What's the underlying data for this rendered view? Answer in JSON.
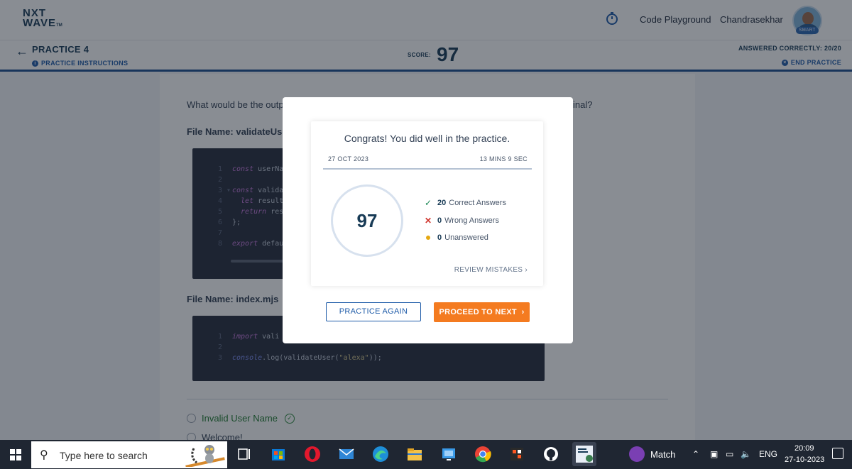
{
  "brand": {
    "line1": "NXT",
    "line2": "WAVE",
    "tm": "TM"
  },
  "topnav": {
    "code_playground": "Code Playground",
    "user_name": "Chandrasekhar",
    "avatar_badge": "SMART"
  },
  "subheader": {
    "title": "PRACTICE 4",
    "instructions": "PRACTICE INSTRUCTIONS",
    "score_label": "SCORE:",
    "score_value": "97",
    "answered": "ANSWERED CORRECTLY: 20/20",
    "end_practice": "END PRACTICE"
  },
  "question": {
    "text_left": "What would be the outp",
    "text_right": "inal?",
    "file1": "File Name: validateUse",
    "file2": "File Name: index.mjs",
    "code1": [
      {
        "n": "1",
        "kw": "const",
        "rest": " userNa"
      },
      {
        "n": "2",
        "kw": "",
        "rest": ""
      },
      {
        "n": "3 ▾",
        "kw": "const",
        "rest": " valida"
      },
      {
        "n": "4",
        "kw": "  let",
        "rest": " result"
      },
      {
        "n": "5",
        "kw": "  return",
        "rest": " res"
      },
      {
        "n": "6",
        "kw": "",
        "rest": "};"
      },
      {
        "n": "7",
        "kw": "",
        "rest": ""
      },
      {
        "n": "8",
        "kw": "export",
        "rest": " defau"
      }
    ],
    "code2": [
      {
        "n": "1",
        "kw": "import",
        "rest": " vali"
      },
      {
        "n": "2",
        "kw": "",
        "rest": ""
      },
      {
        "n": "3",
        "kw": "console",
        "rest": ".log(validateUser(",
        "str": "\"alexa\"",
        "tail": "));"
      }
    ],
    "options": [
      "Invalid User Name",
      "Welcome!"
    ]
  },
  "modal": {
    "congrats": "Congrats! You did well in the practice.",
    "date": "27 OCT 2023",
    "duration": "13 MINS 9 SEC",
    "score": "97",
    "stats": [
      {
        "count": "20",
        "label": "Correct Answers"
      },
      {
        "count": "0",
        "label": "Wrong Answers"
      },
      {
        "count": "0",
        "label": "Unanswered"
      }
    ],
    "review": "REVIEW MISTAKES",
    "practice_again": "PRACTICE AGAIN",
    "proceed_next": "PROCEED TO NEXT"
  },
  "taskbar": {
    "search_placeholder": "Type here to search",
    "match": "Match",
    "lang": "ENG",
    "time": "20:09",
    "date": "27-10-2023"
  },
  "colors": {
    "brand_blue": "#183b56",
    "accent_orange": "#f47b20",
    "link_blue": "#1e5ba8",
    "success_green": "#1a8754",
    "error_red": "#d0342c"
  }
}
